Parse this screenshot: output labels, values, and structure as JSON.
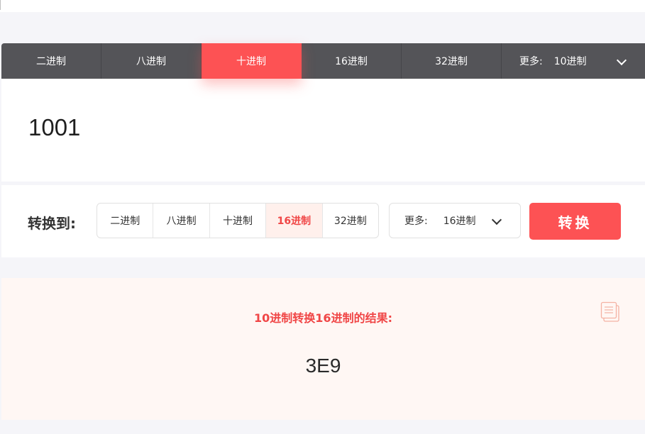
{
  "source_tabs": {
    "items": [
      {
        "label": "二进制"
      },
      {
        "label": "八进制"
      },
      {
        "label": "十进制"
      },
      {
        "label": "16进制"
      },
      {
        "label": "32进制"
      }
    ],
    "active_index": 2,
    "more_label": "更多:",
    "more_value": "10进制",
    "more_icon": "chevron-down-icon"
  },
  "input": {
    "value": "1001"
  },
  "convert": {
    "label": "转换到:",
    "target_tabs": [
      {
        "label": "二进制"
      },
      {
        "label": "八进制"
      },
      {
        "label": "十进制"
      },
      {
        "label": "16进制"
      },
      {
        "label": "32进制"
      }
    ],
    "active_index": 3,
    "more_label": "更多:",
    "more_value": "16进制",
    "more_icon": "chevron-down-icon",
    "button_label": "转换"
  },
  "result": {
    "title": "10进制转换16进制的结果:",
    "value": "3E9",
    "copy_icon": "copy-icon"
  },
  "colors": {
    "accent": "#fd5254",
    "dark_bar": "#545458",
    "result_bg": "#fff7f4",
    "page_bg": "#f5f5f9"
  }
}
